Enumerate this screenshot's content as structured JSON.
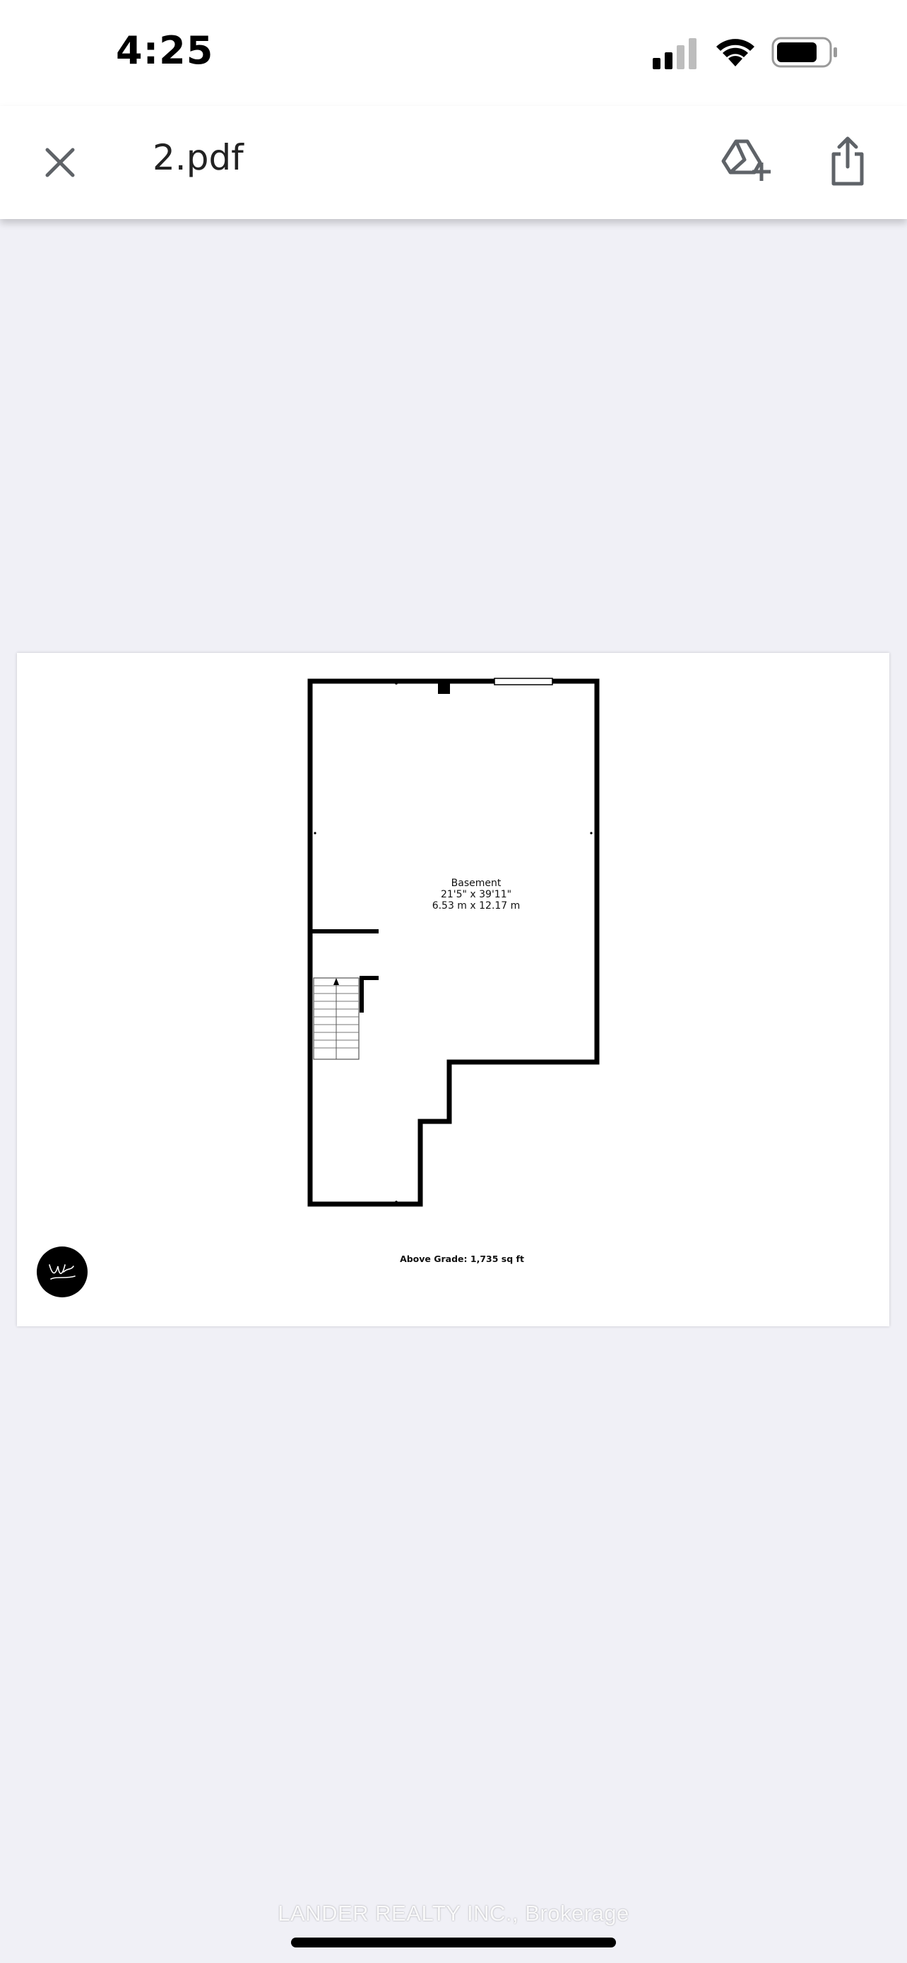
{
  "status_bar": {
    "time": "4:25",
    "icons": [
      "cellular-signal-icon",
      "wifi-icon",
      "battery-icon"
    ]
  },
  "app_bar": {
    "title": "2.pdf",
    "close_icon": "close-icon",
    "drive_icon": "add-to-drive-icon",
    "share_icon": "share-icon"
  },
  "floorplan": {
    "room": {
      "name": "Basement",
      "dimensions_imperial": "21'5\" x 39'11\"",
      "dimensions_metric": "6.53 m x 12.17 m"
    },
    "note": "Above Grade: 1,735 sq ft",
    "logo_icon": "brand-logo-icon"
  },
  "watermark": "LANDER REALTY INC., Brokerage",
  "colors": {
    "background": "#f0f0f6",
    "app_bar": "#ffffff",
    "icon_color": "#5f6368",
    "wall": "#000000"
  }
}
